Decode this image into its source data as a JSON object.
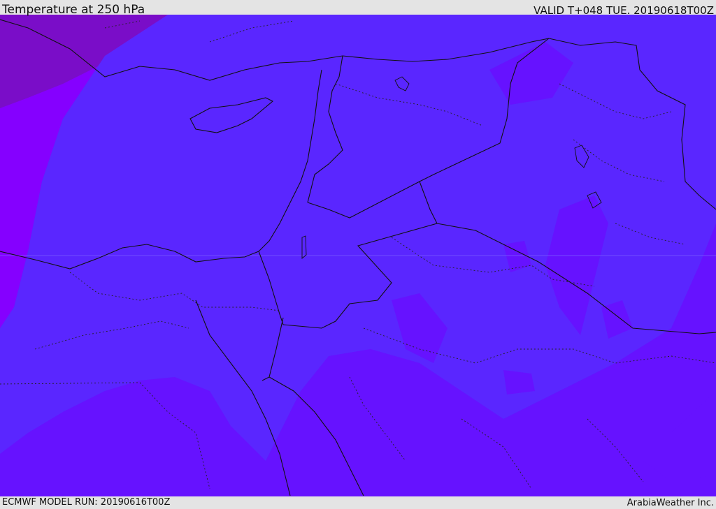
{
  "header": {
    "title": "Temperature at 250 hPa",
    "valid": "VALID T+048 TUE. 20190618T00Z"
  },
  "footer": {
    "model_run": "ECMWF MODEL RUN: 20190616T00Z",
    "credit": "ArabiaWeather Inc."
  },
  "colors": {
    "coldest": "#7a0dc8",
    "cold": "#8500ff",
    "mid": "#6612ff",
    "warm": "#5a26ff",
    "border": "#111111",
    "bar_bg": "#e4e4e4"
  }
}
